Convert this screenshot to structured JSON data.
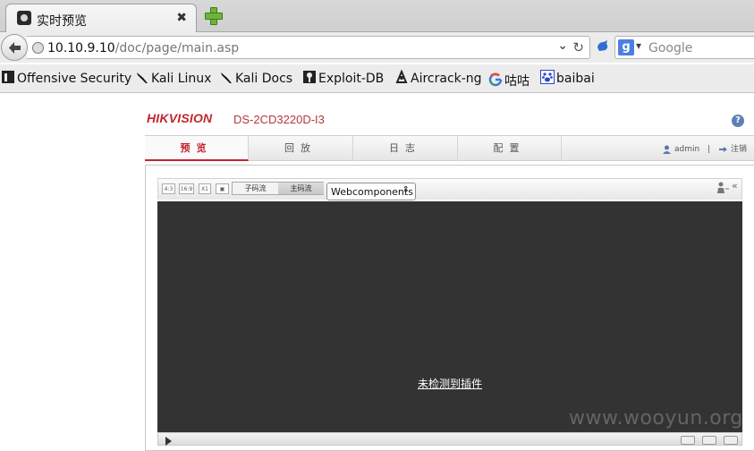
{
  "browser": {
    "tab_title": "实时预览",
    "tab_close": "✖",
    "url_host": "10.10.9.10",
    "url_path": "/doc/page/main.asp",
    "search_placeholder": "Google",
    "search_engine_letter": "g"
  },
  "bookmarks": [
    {
      "label": "Offensive Security",
      "icon": "offsec-icon"
    },
    {
      "label": "Kali Linux",
      "icon": "kali-dragon-icon"
    },
    {
      "label": "Kali Docs",
      "icon": "kali-dragon-icon"
    },
    {
      "label": "Exploit-DB",
      "icon": "exploitdb-icon"
    },
    {
      "label": "Aircrack-ng",
      "icon": "aircrack-icon"
    },
    {
      "label": "咕咕",
      "icon": "google-icon"
    },
    {
      "label": "baibai",
      "icon": "baidu-paw-icon"
    }
  ],
  "page": {
    "brand": "HIKVISION",
    "model": "DS-2CD3220D-I3",
    "help": "?",
    "menu": [
      {
        "label": "预览",
        "active": true
      },
      {
        "label": "回放",
        "active": false
      },
      {
        "label": "日志",
        "active": false
      },
      {
        "label": "配置",
        "active": false
      }
    ],
    "user": "admin",
    "user_sep": "|",
    "logout": "注销",
    "ratio_buttons": [
      "4:3",
      "16:9",
      "X1",
      "▣"
    ],
    "streams": {
      "sub": "子码流",
      "main": "主码流"
    },
    "plugin_select": "Webcomponents",
    "no_plugin_text": "未检测到插件",
    "collapse": "«"
  },
  "watermark": "www.wooyun.org",
  "colors": {
    "brand_red": "#c3262f",
    "video_bg": "#333333"
  }
}
